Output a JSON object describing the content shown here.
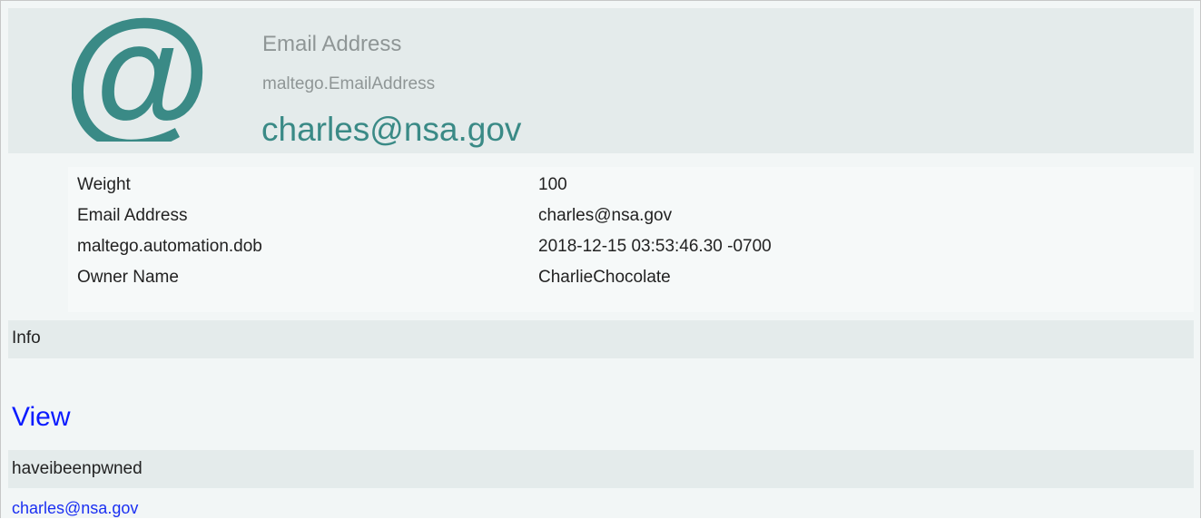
{
  "entity": {
    "type_name": "Email Address",
    "type_id": "maltego.EmailAddress",
    "value": "charles@nsa.gov",
    "icon": "at-sign-icon",
    "accent_color": "#3a8a86"
  },
  "properties": [
    {
      "key": "Weight",
      "value": "100"
    },
    {
      "key": "Email Address",
      "value": "charles@nsa.gov"
    },
    {
      "key": "maltego.automation.dob",
      "value": "2018-12-15 03:53:46.30 -0700"
    },
    {
      "key": "Owner Name",
      "value": "CharlieChocolate"
    }
  ],
  "sections": {
    "info_label": "Info",
    "view_link": "View",
    "source_label": "haveibeenpwned",
    "source_link": "charles@nsa.gov"
  }
}
